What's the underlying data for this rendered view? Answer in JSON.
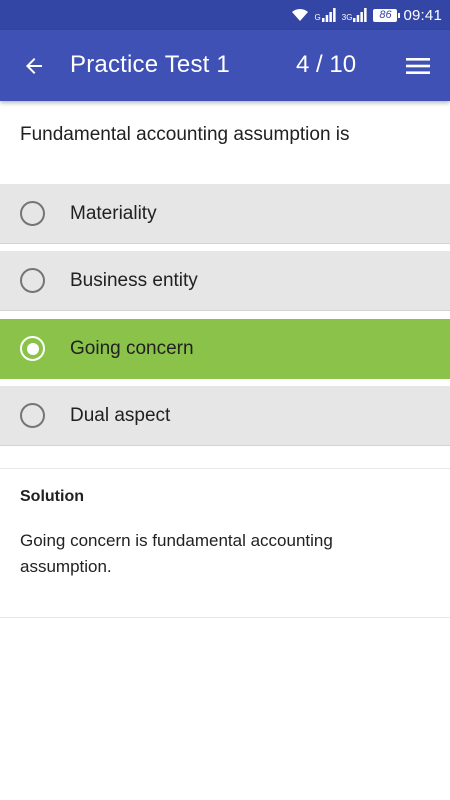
{
  "status_bar": {
    "net_label_1": "G",
    "net_label_2": "3G",
    "battery": "86",
    "time": "09:41"
  },
  "app_bar": {
    "title": "Practice Test 1",
    "current_question": "4",
    "separator": " / ",
    "total_questions": "10"
  },
  "question": {
    "text": "Fundamental accounting assumption is"
  },
  "options": [
    {
      "label": "Materiality",
      "selected": false
    },
    {
      "label": "Business entity",
      "selected": false
    },
    {
      "label": "Going concern",
      "selected": true
    },
    {
      "label": "Dual aspect",
      "selected": false
    }
  ],
  "solution": {
    "title": "Solution",
    "text": "Going concern is fundamental accounting assumption."
  },
  "colors": {
    "primary": "#3f51b5",
    "primary_dark": "#3346a6",
    "selected": "#8bc34a",
    "option_bg": "#e6e6e6"
  }
}
